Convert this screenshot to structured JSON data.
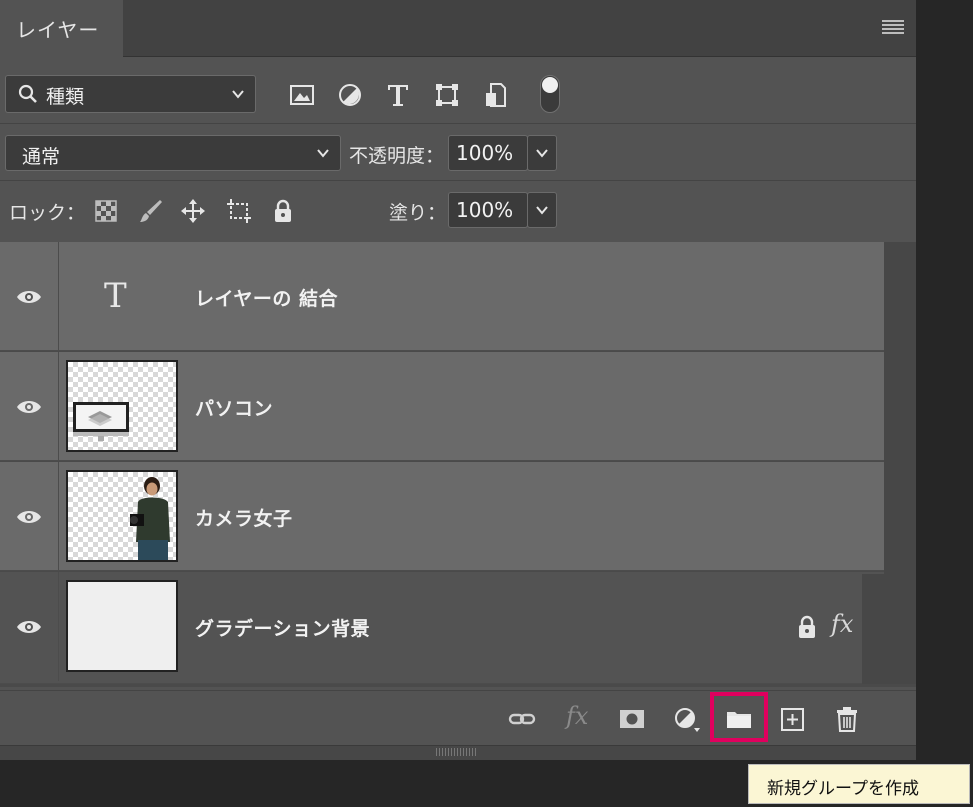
{
  "panel": {
    "tab_label": "レイヤー"
  },
  "filter": {
    "kind_label": "種類"
  },
  "blend": {
    "mode": "通常",
    "opacity_label": "不透明度：",
    "opacity_value": "100%"
  },
  "lock": {
    "label": "ロック：",
    "fill_label": "塗り：",
    "fill_value": "100%"
  },
  "layers": [
    {
      "name": "レイヤーの 結合",
      "type": "text"
    },
    {
      "name": "パソコン",
      "type": "image"
    },
    {
      "name": "カメラ女子",
      "type": "image"
    },
    {
      "name": "グラデーション背景",
      "type": "background",
      "fx_label": "fx"
    }
  ],
  "footer": {
    "fx_label": "fx"
  },
  "tooltip": {
    "text": "新規グループを作成"
  },
  "colors": {
    "highlight": "#e0005e",
    "panel": "#535353",
    "selected_row": "#6a6a6a"
  }
}
